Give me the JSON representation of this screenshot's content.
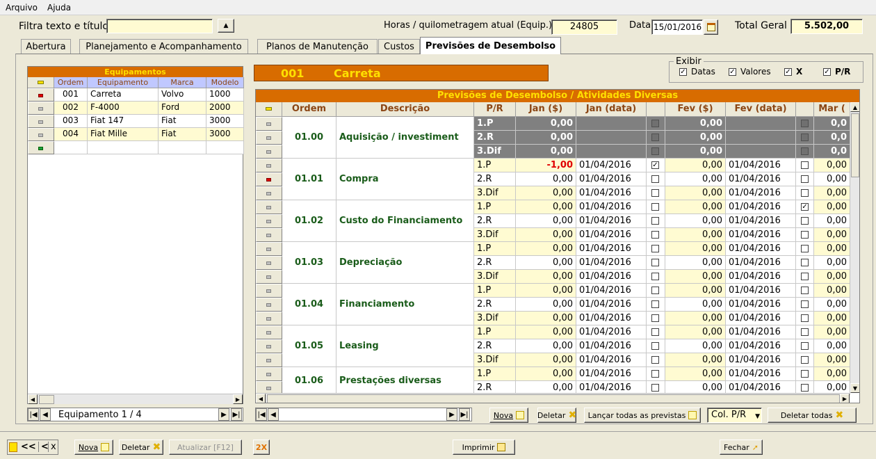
{
  "menu": {
    "file": "Arquivo",
    "help": "Ajuda"
  },
  "toolbar": {
    "filter_label": "Filtra texto e títulos",
    "filter_value": "",
    "hours_label": "Horas / quilometragem atual (Equip.)",
    "hours_value": "24805",
    "date_label": "Data",
    "date_value": "15/01/2016",
    "total_label": "Total Geral",
    "total_value": "5.502,00"
  },
  "tabs": [
    "Abertura",
    "Planejamento e Acompanhamento",
    "Planos de Manutenção",
    "Custos",
    "Previsões de Desembolso"
  ],
  "equip": {
    "title": "Equipamentos",
    "headers": [
      "Ordem",
      "Equipamento",
      "Marca",
      "Modelo"
    ],
    "rows": [
      [
        "001",
        "Carreta",
        "Volvo",
        "1000"
      ],
      [
        "002",
        "F-4000",
        "Ford",
        "2000"
      ],
      [
        "003",
        "Fiat 147",
        "Fiat",
        "3000"
      ],
      [
        "004",
        "Fiat Mille",
        "Fiat",
        "3000"
      ]
    ],
    "status": "Equipamento 1 / 4"
  },
  "selected": {
    "code": "001",
    "name": "Carreta"
  },
  "exibir": {
    "title": "Exibir",
    "options": [
      {
        "label": "Datas",
        "checked": true
      },
      {
        "label": "Valores",
        "checked": true
      },
      {
        "label": "X",
        "checked": true
      },
      {
        "label": "P/R",
        "checked": true
      }
    ]
  },
  "grid": {
    "title": "Previsões de Desembolso / Atividades Diversas",
    "headers": [
      "Ordem",
      "Descrição",
      "P/R",
      "Jan ($)",
      "Jan (data)",
      "",
      "Fev ($)",
      "Fev (data)",
      "",
      "Mar ("
    ],
    "groups": [
      {
        "ordem": "01.00",
        "desc": "Aquisição / investiment",
        "dark": true,
        "rows": [
          {
            "pr": "1.P",
            "jan": "0,00",
            "jand": "",
            "janx": false,
            "fev": "0,00",
            "fevd": "",
            "fevx": false,
            "mar": "0,0"
          },
          {
            "pr": "2.R",
            "jan": "0,00",
            "jand": "",
            "janx": false,
            "fev": "0,00",
            "fevd": "",
            "fevx": false,
            "mar": "0,0"
          },
          {
            "pr": "3.Dif",
            "jan": "0,00",
            "jand": "",
            "janx": false,
            "fev": "0,00",
            "fevd": "",
            "fevx": false,
            "mar": "0,0"
          }
        ]
      },
      {
        "ordem": "01.01",
        "desc": "Compra",
        "rows": [
          {
            "pr": "1.P",
            "jan": "-1,00",
            "jand": "01/04/2016",
            "janx": true,
            "fev": "0,00",
            "fevd": "01/04/2016",
            "fevx": false,
            "mar": "0,00",
            "neg": true
          },
          {
            "pr": "2.R",
            "jan": "0,00",
            "jand": "01/04/2016",
            "janx": false,
            "fev": "0,00",
            "fevd": "01/04/2016",
            "fevx": false,
            "mar": "0,00"
          },
          {
            "pr": "3.Dif",
            "jan": "0,00",
            "jand": "01/04/2016",
            "janx": false,
            "fev": "0,00",
            "fevd": "01/04/2016",
            "fevx": false,
            "mar": "0,00"
          }
        ]
      },
      {
        "ordem": "01.02",
        "desc": "Custo do Financiamento",
        "rows": [
          {
            "pr": "1.P",
            "jan": "0,00",
            "jand": "01/04/2016",
            "janx": false,
            "fev": "0,00",
            "fevd": "01/04/2016",
            "fevx": true,
            "mar": "0,00"
          },
          {
            "pr": "2.R",
            "jan": "0,00",
            "jand": "01/04/2016",
            "janx": false,
            "fev": "0,00",
            "fevd": "01/04/2016",
            "fevx": false,
            "mar": "0,00"
          },
          {
            "pr": "3.Dif",
            "jan": "0,00",
            "jand": "01/04/2016",
            "janx": false,
            "fev": "0,00",
            "fevd": "01/04/2016",
            "fevx": false,
            "mar": "0,00"
          }
        ]
      },
      {
        "ordem": "01.03",
        "desc": "Depreciação",
        "rows": [
          {
            "pr": "1.P",
            "jan": "0,00",
            "jand": "01/04/2016",
            "janx": false,
            "fev": "0,00",
            "fevd": "01/04/2016",
            "fevx": false,
            "mar": "0,00"
          },
          {
            "pr": "2.R",
            "jan": "0,00",
            "jand": "01/04/2016",
            "janx": false,
            "fev": "0,00",
            "fevd": "01/04/2016",
            "fevx": false,
            "mar": "0,00"
          },
          {
            "pr": "3.Dif",
            "jan": "0,00",
            "jand": "01/04/2016",
            "janx": false,
            "fev": "0,00",
            "fevd": "01/04/2016",
            "fevx": false,
            "mar": "0,00"
          }
        ]
      },
      {
        "ordem": "01.04",
        "desc": "Financiamento",
        "rows": [
          {
            "pr": "1.P",
            "jan": "0,00",
            "jand": "01/04/2016",
            "janx": false,
            "fev": "0,00",
            "fevd": "01/04/2016",
            "fevx": false,
            "mar": "0,00"
          },
          {
            "pr": "2.R",
            "jan": "0,00",
            "jand": "01/04/2016",
            "janx": false,
            "fev": "0,00",
            "fevd": "01/04/2016",
            "fevx": false,
            "mar": "0,00"
          },
          {
            "pr": "3.Dif",
            "jan": "0,00",
            "jand": "01/04/2016",
            "janx": false,
            "fev": "0,00",
            "fevd": "01/04/2016",
            "fevx": false,
            "mar": "0,00"
          }
        ]
      },
      {
        "ordem": "01.05",
        "desc": "Leasing",
        "rows": [
          {
            "pr": "1.P",
            "jan": "0,00",
            "jand": "01/04/2016",
            "janx": false,
            "fev": "0,00",
            "fevd": "01/04/2016",
            "fevx": false,
            "mar": "0,00"
          },
          {
            "pr": "2.R",
            "jan": "0,00",
            "jand": "01/04/2016",
            "janx": false,
            "fev": "0,00",
            "fevd": "01/04/2016",
            "fevx": false,
            "mar": "0,00"
          },
          {
            "pr": "3.Dif",
            "jan": "0,00",
            "jand": "01/04/2016",
            "janx": false,
            "fev": "0,00",
            "fevd": "01/04/2016",
            "fevx": false,
            "mar": "0,00"
          }
        ]
      },
      {
        "ordem": "01.06",
        "desc": "Prestações diversas",
        "rows": [
          {
            "pr": "1.P",
            "jan": "0,00",
            "jand": "01/04/2016",
            "janx": false,
            "fev": "0,00",
            "fevd": "01/04/2016",
            "fevx": false,
            "mar": "0,00"
          },
          {
            "pr": "2.R",
            "jan": "0,00",
            "jand": "01/04/2016",
            "janx": false,
            "fev": "0,00",
            "fevd": "01/04/2016",
            "fevx": false,
            "mar": "0,00"
          }
        ]
      }
    ]
  },
  "grid_buttons": {
    "nova": "Nova",
    "deletar": "Deletar",
    "lancar": "Lançar todas as previstas",
    "col": "Col. P/R",
    "deletar_todas": "Deletar todas"
  },
  "bottom": {
    "nova": "Nova",
    "deletar": "Deletar",
    "atualizar": "Atualizar [F12]",
    "x2": "2X",
    "imprimir": "Imprimir",
    "fechar": "Fechar",
    "nav_first": "<<",
    "nav_prev": "<",
    "nav_x": "x"
  }
}
